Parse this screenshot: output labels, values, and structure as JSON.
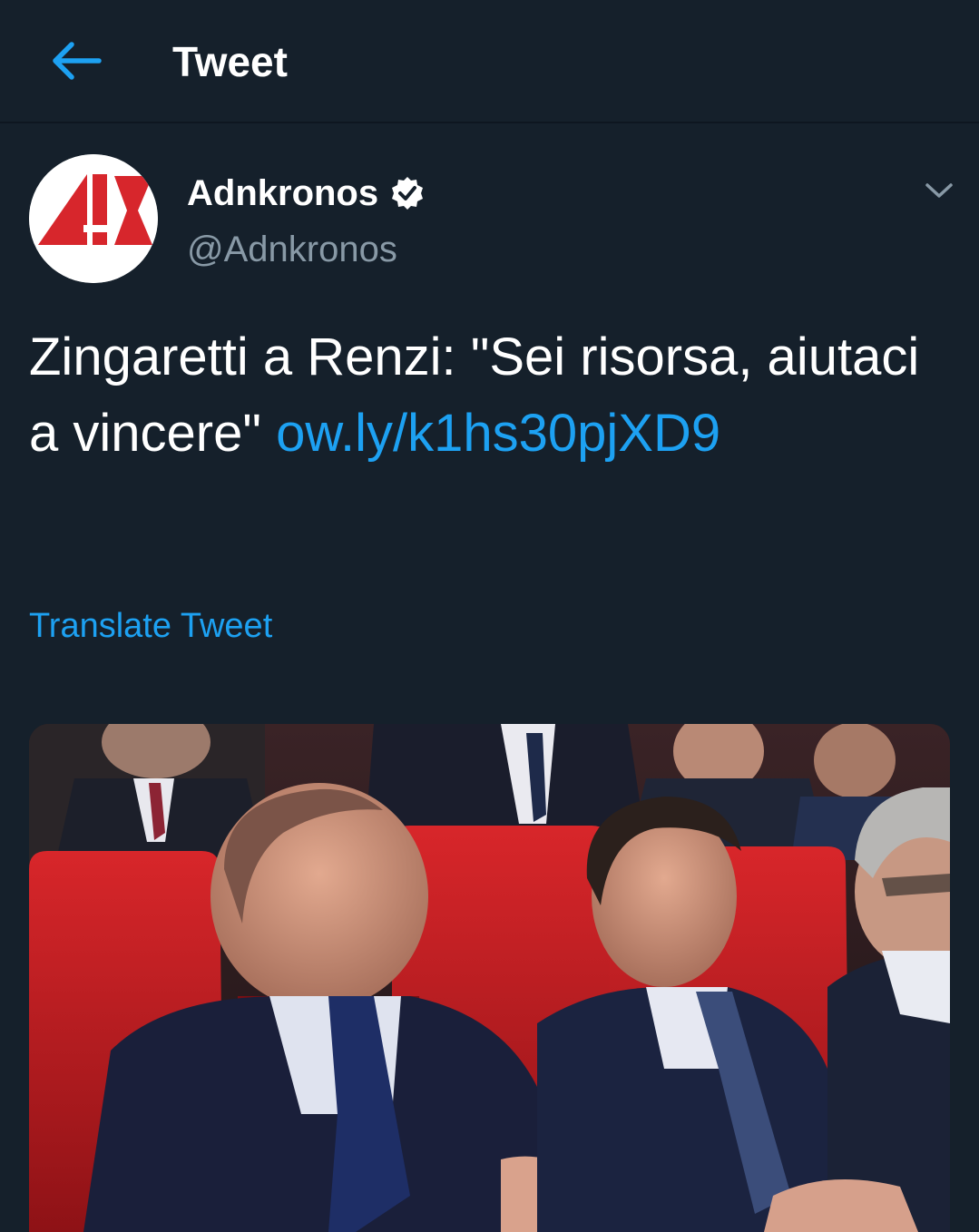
{
  "header": {
    "title": "Tweet",
    "back_icon": "arrow-left-icon",
    "accent_color": "#1da1f2"
  },
  "tweet": {
    "author_name": "Adnkronos",
    "author_handle": "@Adnkronos",
    "verified_icon": "verified-badge-icon",
    "caret_icon": "chevron-down-icon",
    "text": "Zingaretti a Renzi: \"Sei risorsa, aiutaci a vincere\"",
    "link_text": "ow.ly/​k1hs30pjXD9",
    "translate_label": "Translate Tweet",
    "media_alt_icon": "photo-icon"
  },
  "colors": {
    "background": "#15202b",
    "secondary_text": "#8899a6",
    "link": "#1da1f2",
    "logo_red": "#d7262c"
  }
}
